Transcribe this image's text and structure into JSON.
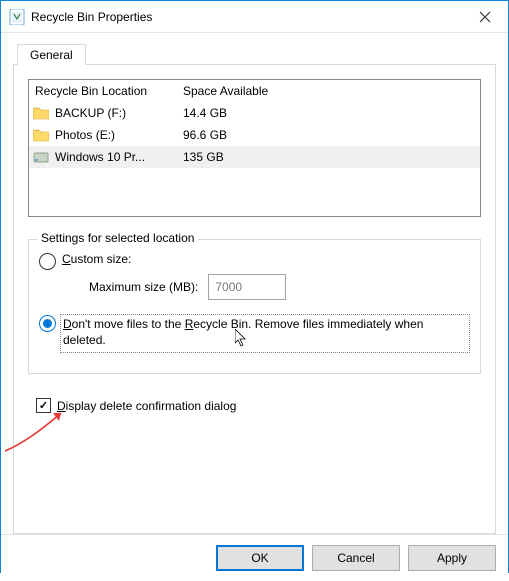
{
  "window": {
    "title": "Recycle Bin Properties"
  },
  "tab": {
    "label": "General"
  },
  "listview": {
    "col1": "Recycle Bin Location",
    "col2": "Space Available",
    "rows": [
      {
        "name": "BACKUP (F:)",
        "space": "14.4 GB",
        "icon": "folder",
        "selected": false
      },
      {
        "name": "Photos (E:)",
        "space": "96.6 GB",
        "icon": "folder",
        "selected": false
      },
      {
        "name": "Windows 10 Pr...",
        "space": "135 GB",
        "icon": "disk",
        "selected": true
      }
    ]
  },
  "group": {
    "title": "Settings for selected location",
    "custom_size_pre": "C",
    "custom_size_rest": "ustom size:",
    "max_size_label": "Maximum size (MB):",
    "max_size_value": "7000",
    "dont_move_pre": "D",
    "dont_move_mid1": "on't move files to the ",
    "dont_move_u2": "R",
    "dont_move_rest": "ecycle Bin. Remove files immediately when deleted."
  },
  "checkbox": {
    "pre": "D",
    "rest": "isplay delete confirmation dialog"
  },
  "buttons": {
    "ok": "OK",
    "cancel": "Cancel",
    "apply": "Apply"
  }
}
